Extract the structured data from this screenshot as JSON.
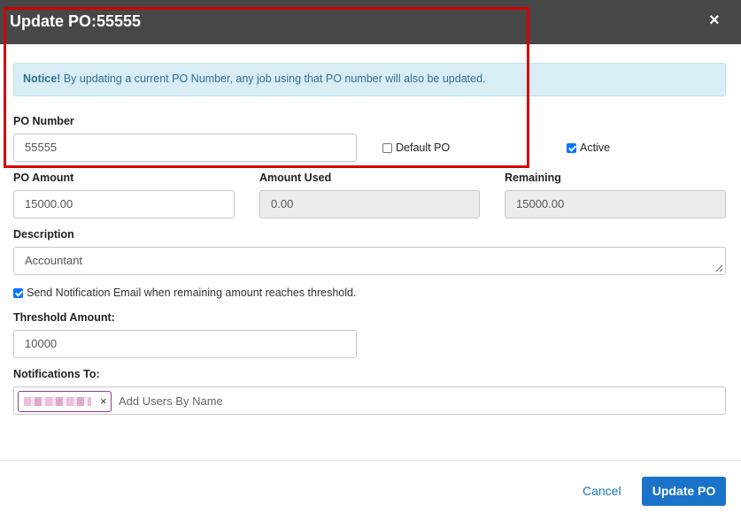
{
  "header": {
    "title": "Update PO:55555",
    "close_label": "×"
  },
  "notice": {
    "strong": "Notice!",
    "text": " By updating a current PO Number, any job using that PO number will also be updated."
  },
  "po_number": {
    "label": "PO Number",
    "value": "55555"
  },
  "default_po": {
    "label": "Default PO",
    "checked": false
  },
  "active": {
    "label": "Active",
    "checked": true
  },
  "po_amount": {
    "label": "PO Amount",
    "value": "15000.00"
  },
  "amount_used": {
    "label": "Amount Used",
    "value": "0.00"
  },
  "remaining": {
    "label": "Remaining",
    "value": "15000.00"
  },
  "description": {
    "label": "Description",
    "value": "Accountant"
  },
  "send_notification": {
    "label": "Send Notification Email when remaining amount reaches threshold.",
    "checked": true
  },
  "threshold": {
    "label": "Threshold Amount:",
    "value": "10000"
  },
  "notifications": {
    "label": "Notifications To:",
    "remove_label": "×",
    "placeholder": "Add Users By Name"
  },
  "footer": {
    "cancel_label": "Cancel",
    "update_label": "Update PO"
  },
  "colors": {
    "header_bg": "#474747",
    "primary": "#1a73c8",
    "notice_bg": "#d9edf7",
    "highlight": "#d40000"
  }
}
